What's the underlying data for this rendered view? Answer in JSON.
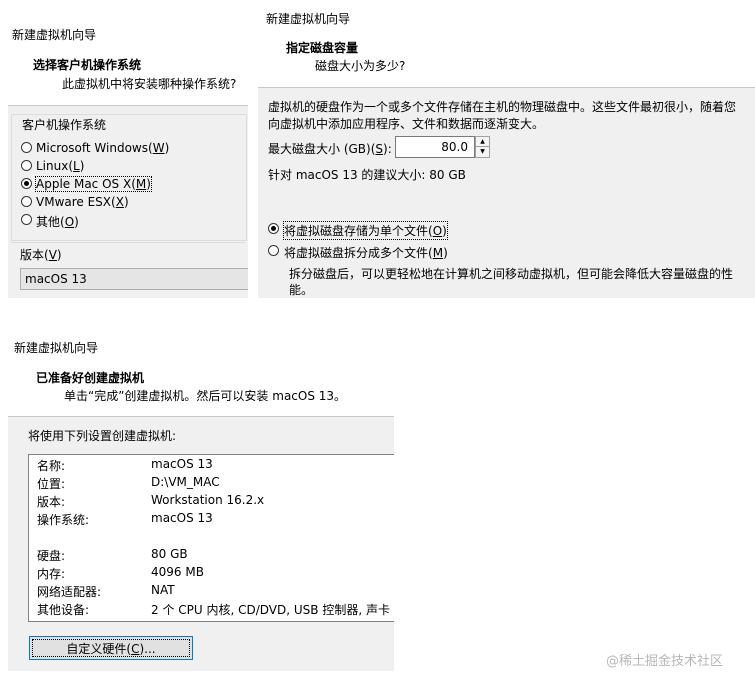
{
  "os_step": {
    "window_title": "新建虚拟机向导",
    "heading": "选择客户机操作系统",
    "subheading": "此虚拟机中将安装哪种操作系统?",
    "group_label": "客户机操作系统",
    "options": [
      {
        "label": "Microsoft Windows",
        "key": "W",
        "selected": false
      },
      {
        "label": "Linux",
        "key": "L",
        "selected": false
      },
      {
        "label": "Apple Mac OS X",
        "key": "M",
        "selected": true
      },
      {
        "label": "VMware ESX",
        "key": "X",
        "selected": false
      },
      {
        "label": "其他",
        "key": "O",
        "selected": false
      }
    ],
    "version_label": "版本",
    "version_key": "V",
    "version_value": "macOS 13"
  },
  "disk_step": {
    "window_title": "新建虚拟机向导",
    "heading": "指定磁盘容量",
    "subheading": "磁盘大小为多少?",
    "description_line1": "虚拟机的硬盘作为一个或多个文件存储在主机的物理磁盘中。这些文件最初很小，随着您",
    "description_line2": "向虚拟机中添加应用程序、文件和数据而逐渐变大。",
    "max_size_label": "最大磁盘大小 (GB)(",
    "max_size_key": "S",
    "max_size_suffix": "):",
    "max_size_value": "80.0",
    "recommend": "针对 macOS 13 的建议大小: 80 GB",
    "options": [
      {
        "label": "将虚拟磁盘存储为单个文件",
        "key": "O",
        "selected": true
      },
      {
        "label": "将虚拟磁盘拆分成多个文件",
        "key": "M",
        "selected": false
      }
    ],
    "split_note_line1": "拆分磁盘后，可以更轻松地在计算机之间移动虚拟机，但可能会降低大容量磁盘的性",
    "split_note_line2": "能。"
  },
  "finish_step": {
    "window_title": "新建虚拟机向导",
    "heading": "已准备好创建虚拟机",
    "subheading": "单击“完成”创建虚拟机。然后可以安装 macOS 13。",
    "intro": "将使用下列设置创建虚拟机:",
    "settings": [
      {
        "key": "名称:",
        "value": "macOS 13"
      },
      {
        "key": "位置:",
        "value": "D:\\VM_MAC"
      },
      {
        "key": "版本:",
        "value": "Workstation 16.2.x"
      },
      {
        "key": "操作系统:",
        "value": "macOS 13"
      },
      {
        "key": "",
        "value": ""
      },
      {
        "key": "硬盘:",
        "value": "80 GB"
      },
      {
        "key": "内存:",
        "value": "4096 MB"
      },
      {
        "key": "网络适配器:",
        "value": "NAT"
      },
      {
        "key": "其他设备:",
        "value": "2 个 CPU 内核, CD/DVD, USB 控制器, 声卡"
      }
    ],
    "customize_label": "自定义硬件(",
    "customize_key": "C",
    "customize_suffix": ")..."
  },
  "watermark": "@稀土掘金技术社区"
}
